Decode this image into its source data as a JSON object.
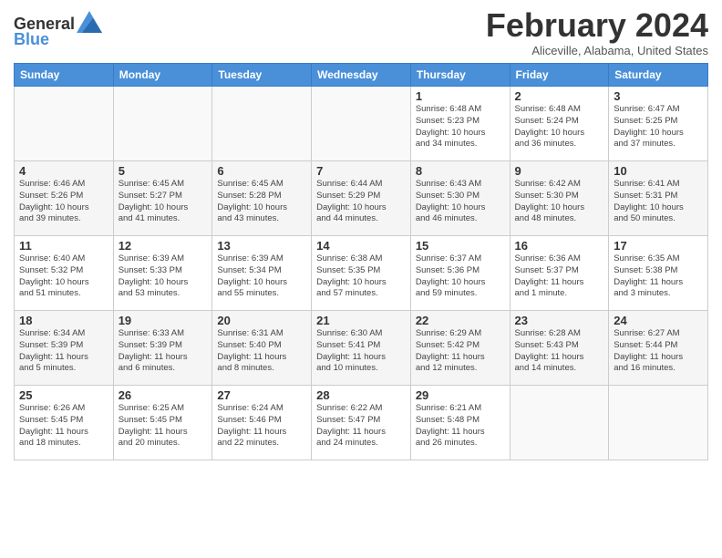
{
  "header": {
    "logo_line1": "General",
    "logo_line2": "Blue",
    "month_title": "February 2024",
    "location": "Aliceville, Alabama, United States"
  },
  "weekdays": [
    "Sunday",
    "Monday",
    "Tuesday",
    "Wednesday",
    "Thursday",
    "Friday",
    "Saturday"
  ],
  "weeks": [
    [
      {
        "day": "",
        "info": ""
      },
      {
        "day": "",
        "info": ""
      },
      {
        "day": "",
        "info": ""
      },
      {
        "day": "",
        "info": ""
      },
      {
        "day": "1",
        "info": "Sunrise: 6:48 AM\nSunset: 5:23 PM\nDaylight: 10 hours\nand 34 minutes."
      },
      {
        "day": "2",
        "info": "Sunrise: 6:48 AM\nSunset: 5:24 PM\nDaylight: 10 hours\nand 36 minutes."
      },
      {
        "day": "3",
        "info": "Sunrise: 6:47 AM\nSunset: 5:25 PM\nDaylight: 10 hours\nand 37 minutes."
      }
    ],
    [
      {
        "day": "4",
        "info": "Sunrise: 6:46 AM\nSunset: 5:26 PM\nDaylight: 10 hours\nand 39 minutes."
      },
      {
        "day": "5",
        "info": "Sunrise: 6:45 AM\nSunset: 5:27 PM\nDaylight: 10 hours\nand 41 minutes."
      },
      {
        "day": "6",
        "info": "Sunrise: 6:45 AM\nSunset: 5:28 PM\nDaylight: 10 hours\nand 43 minutes."
      },
      {
        "day": "7",
        "info": "Sunrise: 6:44 AM\nSunset: 5:29 PM\nDaylight: 10 hours\nand 44 minutes."
      },
      {
        "day": "8",
        "info": "Sunrise: 6:43 AM\nSunset: 5:30 PM\nDaylight: 10 hours\nand 46 minutes."
      },
      {
        "day": "9",
        "info": "Sunrise: 6:42 AM\nSunset: 5:30 PM\nDaylight: 10 hours\nand 48 minutes."
      },
      {
        "day": "10",
        "info": "Sunrise: 6:41 AM\nSunset: 5:31 PM\nDaylight: 10 hours\nand 50 minutes."
      }
    ],
    [
      {
        "day": "11",
        "info": "Sunrise: 6:40 AM\nSunset: 5:32 PM\nDaylight: 10 hours\nand 51 minutes."
      },
      {
        "day": "12",
        "info": "Sunrise: 6:39 AM\nSunset: 5:33 PM\nDaylight: 10 hours\nand 53 minutes."
      },
      {
        "day": "13",
        "info": "Sunrise: 6:39 AM\nSunset: 5:34 PM\nDaylight: 10 hours\nand 55 minutes."
      },
      {
        "day": "14",
        "info": "Sunrise: 6:38 AM\nSunset: 5:35 PM\nDaylight: 10 hours\nand 57 minutes."
      },
      {
        "day": "15",
        "info": "Sunrise: 6:37 AM\nSunset: 5:36 PM\nDaylight: 10 hours\nand 59 minutes."
      },
      {
        "day": "16",
        "info": "Sunrise: 6:36 AM\nSunset: 5:37 PM\nDaylight: 11 hours\nand 1 minute."
      },
      {
        "day": "17",
        "info": "Sunrise: 6:35 AM\nSunset: 5:38 PM\nDaylight: 11 hours\nand 3 minutes."
      }
    ],
    [
      {
        "day": "18",
        "info": "Sunrise: 6:34 AM\nSunset: 5:39 PM\nDaylight: 11 hours\nand 5 minutes."
      },
      {
        "day": "19",
        "info": "Sunrise: 6:33 AM\nSunset: 5:39 PM\nDaylight: 11 hours\nand 6 minutes."
      },
      {
        "day": "20",
        "info": "Sunrise: 6:31 AM\nSunset: 5:40 PM\nDaylight: 11 hours\nand 8 minutes."
      },
      {
        "day": "21",
        "info": "Sunrise: 6:30 AM\nSunset: 5:41 PM\nDaylight: 11 hours\nand 10 minutes."
      },
      {
        "day": "22",
        "info": "Sunrise: 6:29 AM\nSunset: 5:42 PM\nDaylight: 11 hours\nand 12 minutes."
      },
      {
        "day": "23",
        "info": "Sunrise: 6:28 AM\nSunset: 5:43 PM\nDaylight: 11 hours\nand 14 minutes."
      },
      {
        "day": "24",
        "info": "Sunrise: 6:27 AM\nSunset: 5:44 PM\nDaylight: 11 hours\nand 16 minutes."
      }
    ],
    [
      {
        "day": "25",
        "info": "Sunrise: 6:26 AM\nSunset: 5:45 PM\nDaylight: 11 hours\nand 18 minutes."
      },
      {
        "day": "26",
        "info": "Sunrise: 6:25 AM\nSunset: 5:45 PM\nDaylight: 11 hours\nand 20 minutes."
      },
      {
        "day": "27",
        "info": "Sunrise: 6:24 AM\nSunset: 5:46 PM\nDaylight: 11 hours\nand 22 minutes."
      },
      {
        "day": "28",
        "info": "Sunrise: 6:22 AM\nSunset: 5:47 PM\nDaylight: 11 hours\nand 24 minutes."
      },
      {
        "day": "29",
        "info": "Sunrise: 6:21 AM\nSunset: 5:48 PM\nDaylight: 11 hours\nand 26 minutes."
      },
      {
        "day": "",
        "info": ""
      },
      {
        "day": "",
        "info": ""
      }
    ]
  ]
}
